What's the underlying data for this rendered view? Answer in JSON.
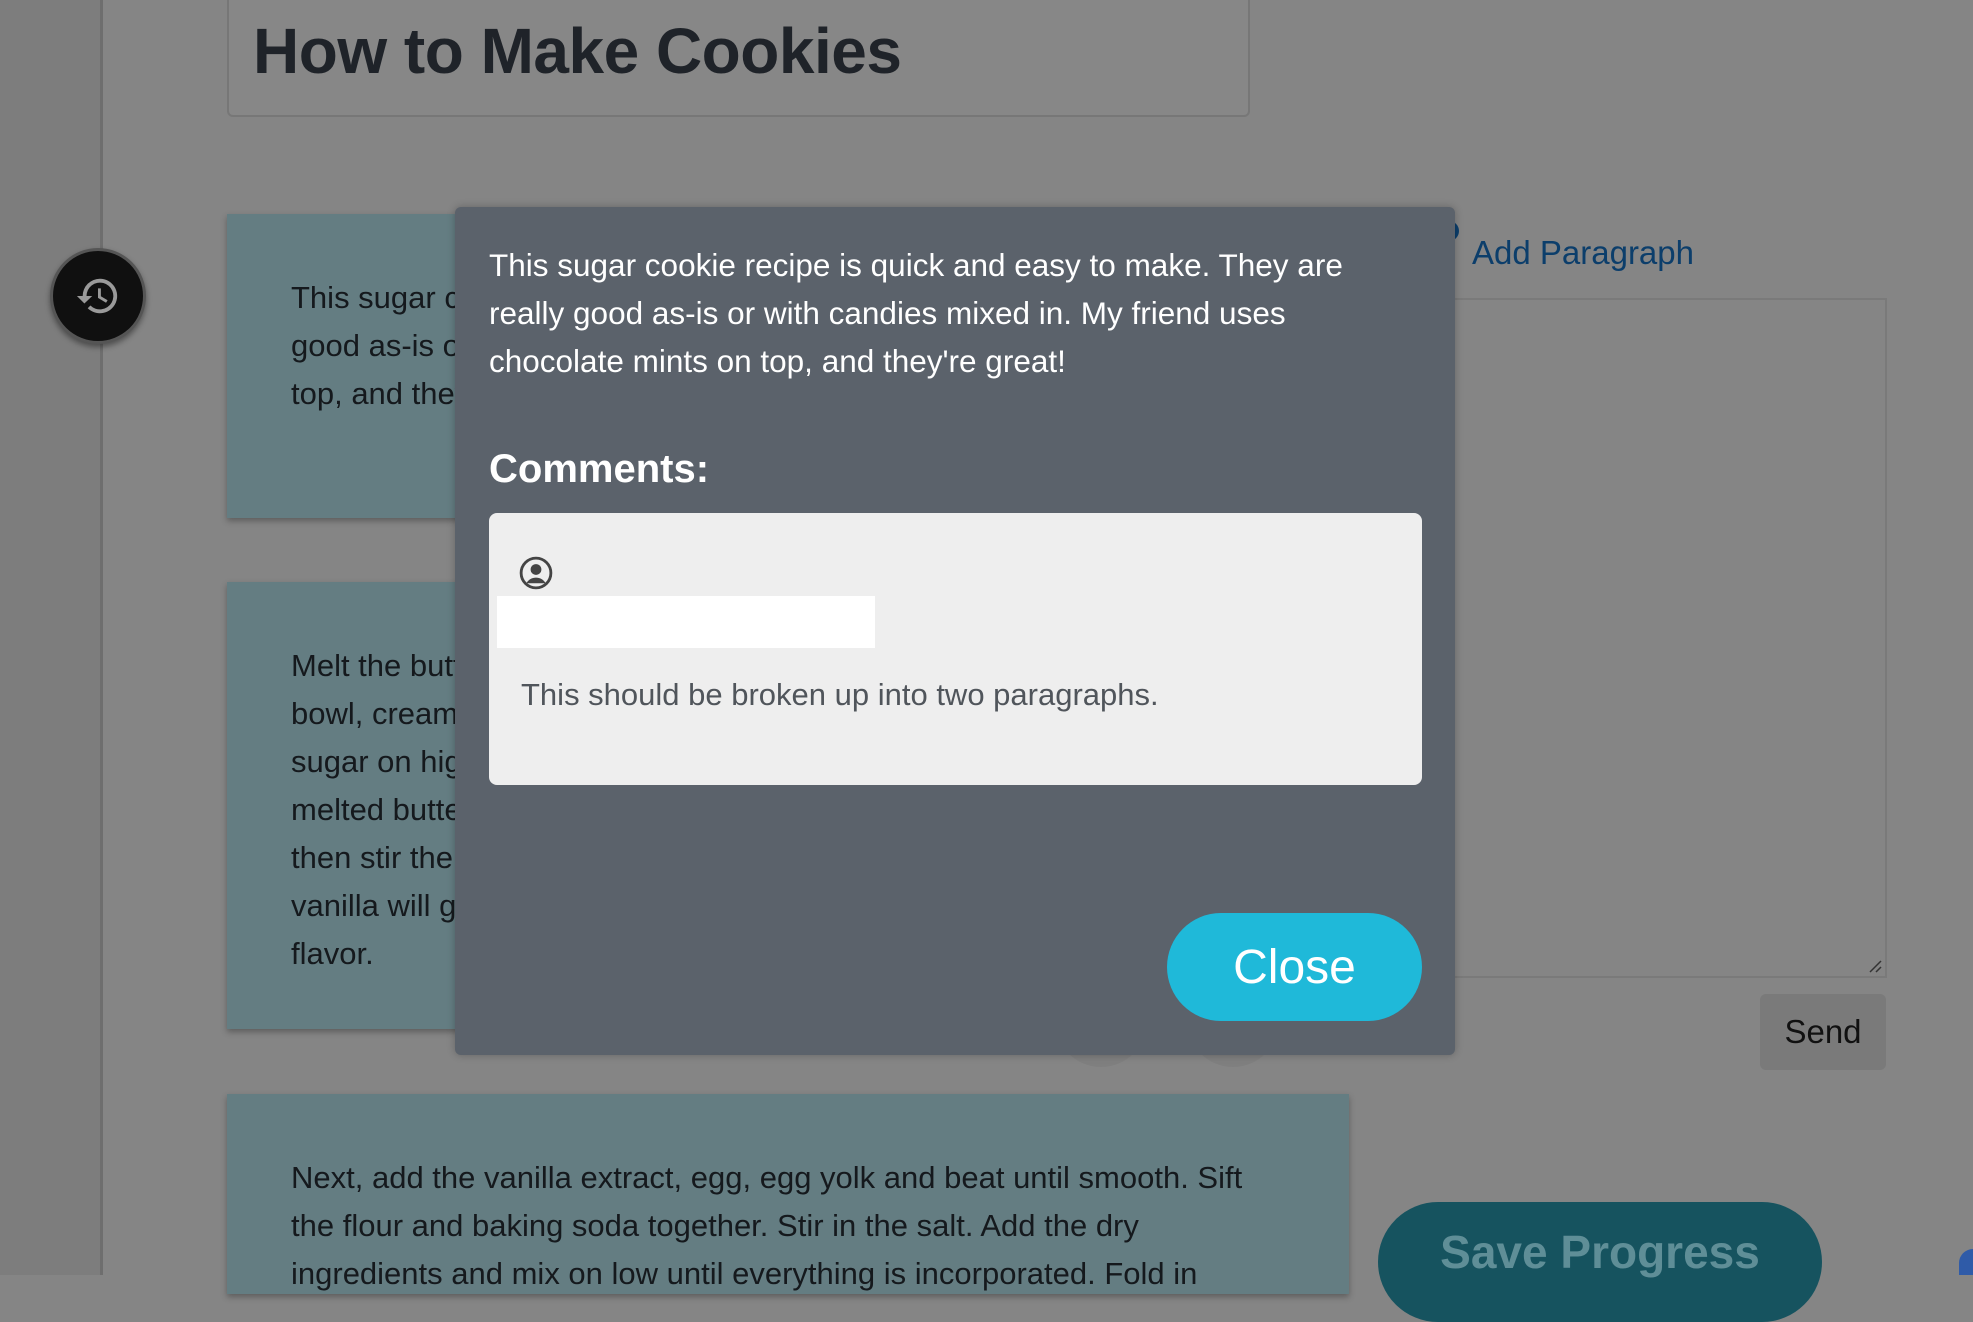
{
  "document": {
    "title": "How to Make Cookies"
  },
  "paragraphs": [
    {
      "text": "This sugar cookie recipe is quick and easy to make. They are really good as-is or with candies mixed in. My friend uses chocolate mints on top, and they're great!"
    },
    {
      "text": "Melt the butter. In a large bowl, cream the butter and sugar on high speed. Pour the melted butter and let cool, then stir them together. A little vanilla will give the cookies flavor."
    },
    {
      "text": "Next, add the vanilla extract, egg, egg yolk and beat until smooth. Sift the flour and baking soda together. Stir in the salt. Add the dry ingredients and mix on low until everything is incorporated. Fold in"
    }
  ],
  "side_panel": {
    "add_paragraph_label": "Add Paragraph",
    "send_label": "Send",
    "save_label": "Save Progress"
  },
  "modal": {
    "paragraph_text": "This sugar cookie recipe is quick and easy to make. They are really good as-is or with candies mixed in. My friend uses chocolate mints on top, and they're great!",
    "comments_heading": "Comments:",
    "comments": [
      {
        "author": "",
        "text": "This should be broken up into two paragraphs."
      }
    ],
    "close_label": "Close"
  },
  "icons": {
    "history": "history-icon",
    "avatar": "user-circle-icon"
  },
  "colors": {
    "accent": "#1fb9d9",
    "modal_bg": "#5b626b",
    "card_bg": "#647d82",
    "save_bg": "#16535f"
  }
}
